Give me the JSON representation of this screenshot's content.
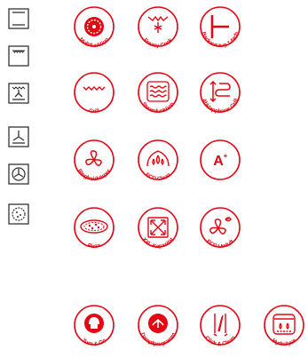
{
  "colors": {
    "brand_red": "#e30613",
    "icon_stroke": "#333333"
  },
  "oven_modes": [
    {
      "icon": "top-bottom-heat-icon"
    },
    {
      "icon": "top-heat-grill-icon"
    },
    {
      "icon": "bottom-heat-fan-icon"
    },
    {
      "icon": "fan-bottom-heat-icon"
    },
    {
      "icon": "hot-air-icon"
    },
    {
      "icon": "pizza-stage-icon"
    }
  ],
  "features": [
    {
      "label": "Multifunktion",
      "icon": "multifunction-icon"
    },
    {
      "label": "Freasy Cook",
      "icon": "freasy-cook-icon"
    },
    {
      "label": "Backauszug 1-fach",
      "icon": "telescopic-rail-icon"
    },
    {
      "label": "Grill",
      "icon": "grill-icon"
    },
    {
      "label": "Steamfunktion",
      "icon": "steam-icon"
    },
    {
      "label": "Abklappbarer Grill",
      "icon": "foldable-grill-icon"
    },
    {
      "label": "Ringheizkörper",
      "icon": "ring-heater-fan-icon"
    },
    {
      "label": "ECO Clean",
      "icon": "eco-clean-icon"
    },
    {
      "label": "",
      "badge": "A",
      "badge_sup": "+",
      "icon": "energy-class-icon"
    },
    {
      "label": "Pizza",
      "icon": "pizza-icon"
    },
    {
      "label": "XXL-Kapazität",
      "icon": "xxl-capacity-icon"
    },
    {
      "label": "ECO Umluft",
      "icon": "eco-fan-icon"
    },
    {
      "label": "Turn & Go",
      "icon": "turn-and-go-icon"
    },
    {
      "label": "Dampfprogramm",
      "icon": "steam-program-icon"
    },
    {
      "label": "Click & Clean",
      "icon": "click-and-clean-icon"
    },
    {
      "label": "Hydrolyse",
      "icon": "hydrolyse-icon"
    }
  ]
}
